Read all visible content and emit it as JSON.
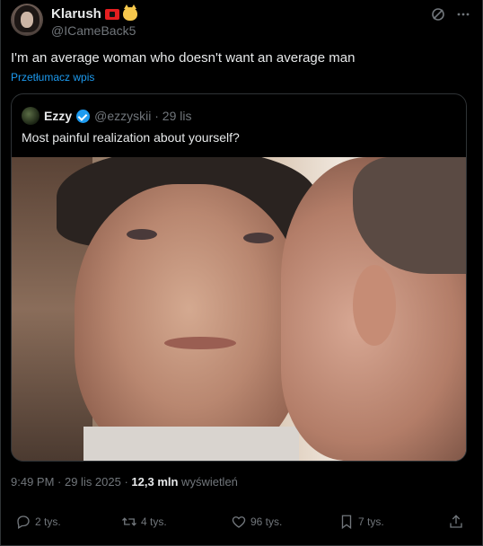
{
  "author": {
    "display_name": "Klarush",
    "handle": "@ICameBack5"
  },
  "tweet": {
    "text": "I'm an average woman who doesn't want an average man",
    "translate_label": "Przetłumacz wpis"
  },
  "quoted": {
    "display_name": "Ezzy",
    "meta": "@ezzyskii · 29 lis",
    "text": "Most painful realization about yourself?"
  },
  "timestamp": {
    "time_date": "9:49 PM · 29 lis 2025 · ",
    "views_count": "12,3 mln",
    "views_label": " wyświetleń"
  },
  "actions": {
    "replies": "2 tys.",
    "retweets": "4 tys.",
    "likes": "96 tys.",
    "bookmarks": "7 tys."
  },
  "icons": [
    "grok-icon",
    "more-icon",
    "reply-icon",
    "retweet-icon",
    "like-icon",
    "bookmark-icon",
    "share-icon"
  ]
}
